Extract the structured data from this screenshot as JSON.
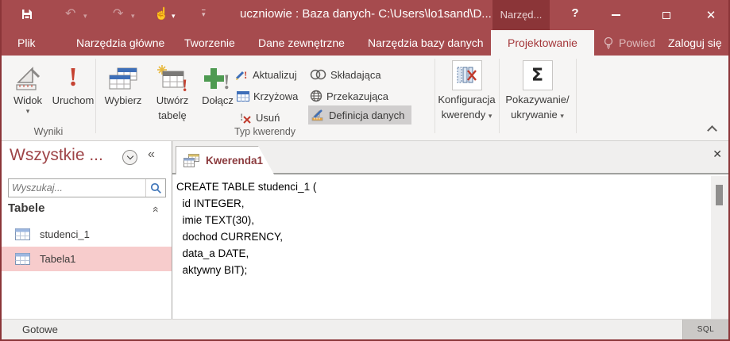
{
  "titlebar": {
    "title": "uczniowie : Baza danych- C:\\Users\\lo1sand\\D...",
    "contextual_tab": "Narzęd...",
    "help": "?"
  },
  "ribbon_tabs": [
    {
      "label": "Plik"
    },
    {
      "label": "Narzędzia główne"
    },
    {
      "label": "Tworzenie"
    },
    {
      "label": "Dane zewnętrzne"
    },
    {
      "label": "Narzędzia bazy danych"
    },
    {
      "label": "Projektowanie",
      "active": true
    },
    {
      "label": "Powied"
    },
    {
      "label": "Zaloguj się"
    }
  ],
  "ribbon": {
    "groups": [
      {
        "label": "Wyniki"
      },
      {
        "label": "Typ kwerendy"
      }
    ],
    "buttons": {
      "widok": "Widok",
      "uruchom": "Uruchom",
      "wybierz": "Wybierz",
      "utworz_1": "Utwórz",
      "utworz_2": "tabelę",
      "dolacz": "Dołącz",
      "aktualizuj": "Aktualizuj",
      "krzyzowa": "Krzyżowa",
      "usun": "Usuń",
      "skladajaca": "Składająca",
      "przekazujaca": "Przekazująca",
      "definicja": "Definicja danych",
      "konfiguracja_1": "Konfiguracja",
      "konfiguracja_2": "kwerendy",
      "pokazywanie_1": "Pokazywanie/",
      "pokazywanie_2": "ukrywanie"
    }
  },
  "nav": {
    "title": "Wszystkie ...",
    "search_placeholder": "Wyszukaj...",
    "section": "Tabele",
    "items": [
      {
        "label": "studenci_1",
        "selected": false
      },
      {
        "label": "Tabela1",
        "selected": true
      }
    ]
  },
  "document": {
    "tab": "Kwerenda1",
    "close": "✕",
    "sql": "CREATE TABLE studenci_1 (\n  id INTEGER,\n  imie TEXT(30),\n  dochod CURRENCY,\n  data_a DATE,\n  aktywny BIT);"
  },
  "statusbar": {
    "status": "Gotowe",
    "view_button": "SQL"
  },
  "icons": {
    "save-icon": "floppy-disk",
    "undo-icon": "↶",
    "redo-icon": "↷",
    "touch-mode-icon": "☝",
    "qat-menu-icon": "⌄",
    "minimize-icon": "—",
    "maximize-icon": "□",
    "close-icon": "✕",
    "lightbulb-icon": "bulb-outline",
    "run-icon": "!",
    "sigma-icon": "Σ",
    "search-icon": "magnifier",
    "table-icon": "datasheet-grid",
    "query-icon": "query-datasheets",
    "dropdown-icon": "▾",
    "shutter-close-icon": "«",
    "section-collapse-icon": "double-chevron-up",
    "ribbon-collapse-icon": "chevron-up"
  },
  "colors": {
    "brand": "#A64B4E",
    "brand_dark": "#8B3538",
    "active_tab_text": "#A4373A",
    "selection_pink": "#F7CCCC",
    "highlight_gray": "#D0CECE"
  }
}
